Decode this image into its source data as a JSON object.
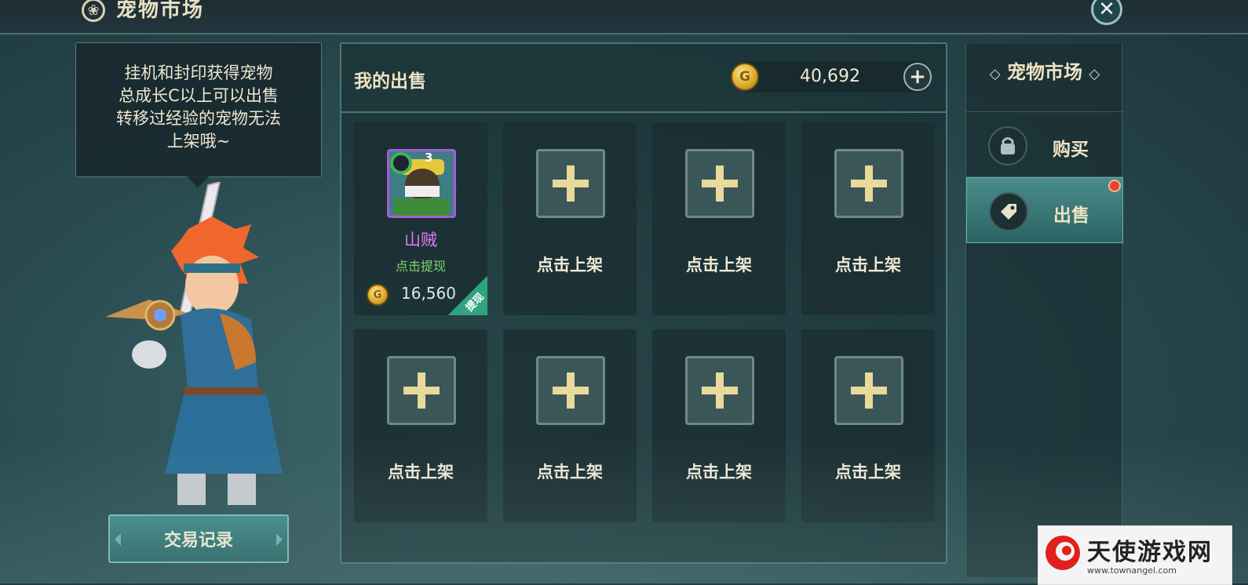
{
  "header": {
    "title": "宠物市场",
    "icon": "pet-badge-icon",
    "close_icon": "close-icon"
  },
  "tip": {
    "lines": [
      "挂机和封印获得宠物",
      "总成长C以上可以出售",
      "转移过经验的宠物无法",
      "上架哦~"
    ]
  },
  "left": {
    "trade_record_label": "交易记录"
  },
  "panel": {
    "title": "我的出售",
    "gold": {
      "value": "40,692",
      "coin_letter": "G",
      "add_icon": "plus-icon"
    }
  },
  "slots": [
    {
      "type": "pet",
      "name": "山贼",
      "action": "点击提现",
      "price": "16,560",
      "level": "3",
      "tag": "提现",
      "coin_letter": "G"
    },
    {
      "type": "empty",
      "label": "点击上架"
    },
    {
      "type": "empty",
      "label": "点击上架"
    },
    {
      "type": "empty",
      "label": "点击上架"
    },
    {
      "type": "empty",
      "label": "点击上架"
    },
    {
      "type": "empty",
      "label": "点击上架"
    },
    {
      "type": "empty",
      "label": "点击上架"
    },
    {
      "type": "empty",
      "label": "点击上架"
    }
  ],
  "sidebar": {
    "title": "宠物市场",
    "title_decor": "◇",
    "items": [
      {
        "label": "购买",
        "icon": "shopping-bag-icon",
        "active": false
      },
      {
        "label": "出售",
        "icon": "price-tag-icon",
        "active": true,
        "notification": true
      }
    ]
  },
  "watermark": {
    "text": "天使游戏网",
    "url": "www.townangel.com"
  },
  "colors": {
    "accent": "#2b6464",
    "gold": "#d9a726",
    "pet_name": "#e277f4",
    "action_green": "#7fd46a",
    "notify_red": "#e2452c"
  }
}
